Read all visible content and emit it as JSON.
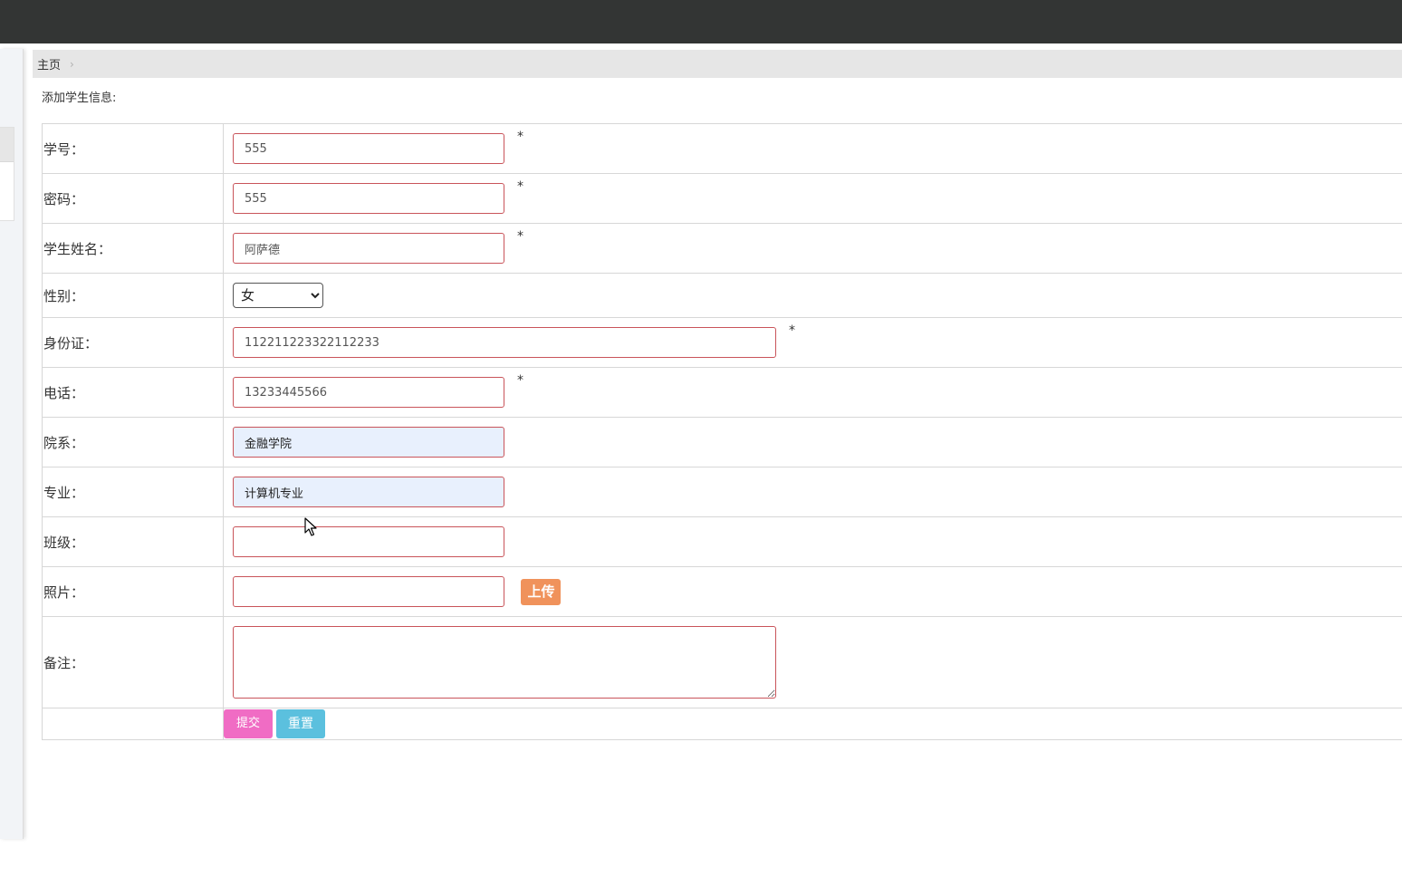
{
  "breadcrumb": {
    "home": "主页",
    "separator": "›"
  },
  "form": {
    "title": "添加学生信息:",
    "required_mark": "*",
    "fields": {
      "student_id": {
        "label": "学号：",
        "value": "555"
      },
      "password": {
        "label": "密码：",
        "value": "555"
      },
      "student_name": {
        "label": "学生姓名：",
        "value": "阿萨德"
      },
      "gender": {
        "label": "性别：",
        "selected": "女"
      },
      "id_card": {
        "label": "身份证：",
        "value": "112211223322112233"
      },
      "phone": {
        "label": "电话：",
        "value": "13233445566"
      },
      "department": {
        "label": "院系：",
        "value": "金融学院"
      },
      "major": {
        "label": "专业：",
        "value": "计算机专业"
      },
      "class": {
        "label": "班级：",
        "value": ""
      },
      "photo": {
        "label": "照片：",
        "value": "",
        "upload_label": "上传"
      },
      "remarks": {
        "label": "备注：",
        "value": ""
      }
    },
    "submit_label": "提交",
    "reset_label": "重置"
  },
  "colors": {
    "topbar": "#333534",
    "input_border": "#c9545a",
    "upload": "#f0925b",
    "submit": "#f06cc4",
    "reset": "#5bc0de",
    "autofill": "#e8f0fd"
  }
}
